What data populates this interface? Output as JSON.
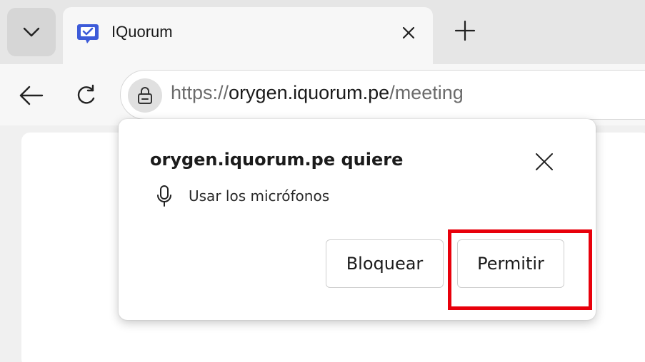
{
  "tab": {
    "title": "IQuorum",
    "favicon_color": "#3d5bd9"
  },
  "address_bar": {
    "scheme": "https://",
    "host": "orygen.iquorum.pe",
    "path": "/meeting"
  },
  "icons": {
    "tab_search": "chevron-down-icon",
    "tab_close": "close-icon",
    "new_tab": "plus-icon",
    "back": "arrow-left-icon",
    "reload": "reload-icon",
    "site_info": "lock-icon",
    "popup_close": "close-icon",
    "permission": "microphone-icon"
  },
  "permission_prompt": {
    "title": "orygen.iquorum.pe quiere",
    "permission_label": "Usar los micrófonos",
    "block_label": "Bloquear",
    "allow_label": "Permitir"
  },
  "colors": {
    "highlight": "#e8000b",
    "favicon": "#3d5bd9"
  }
}
